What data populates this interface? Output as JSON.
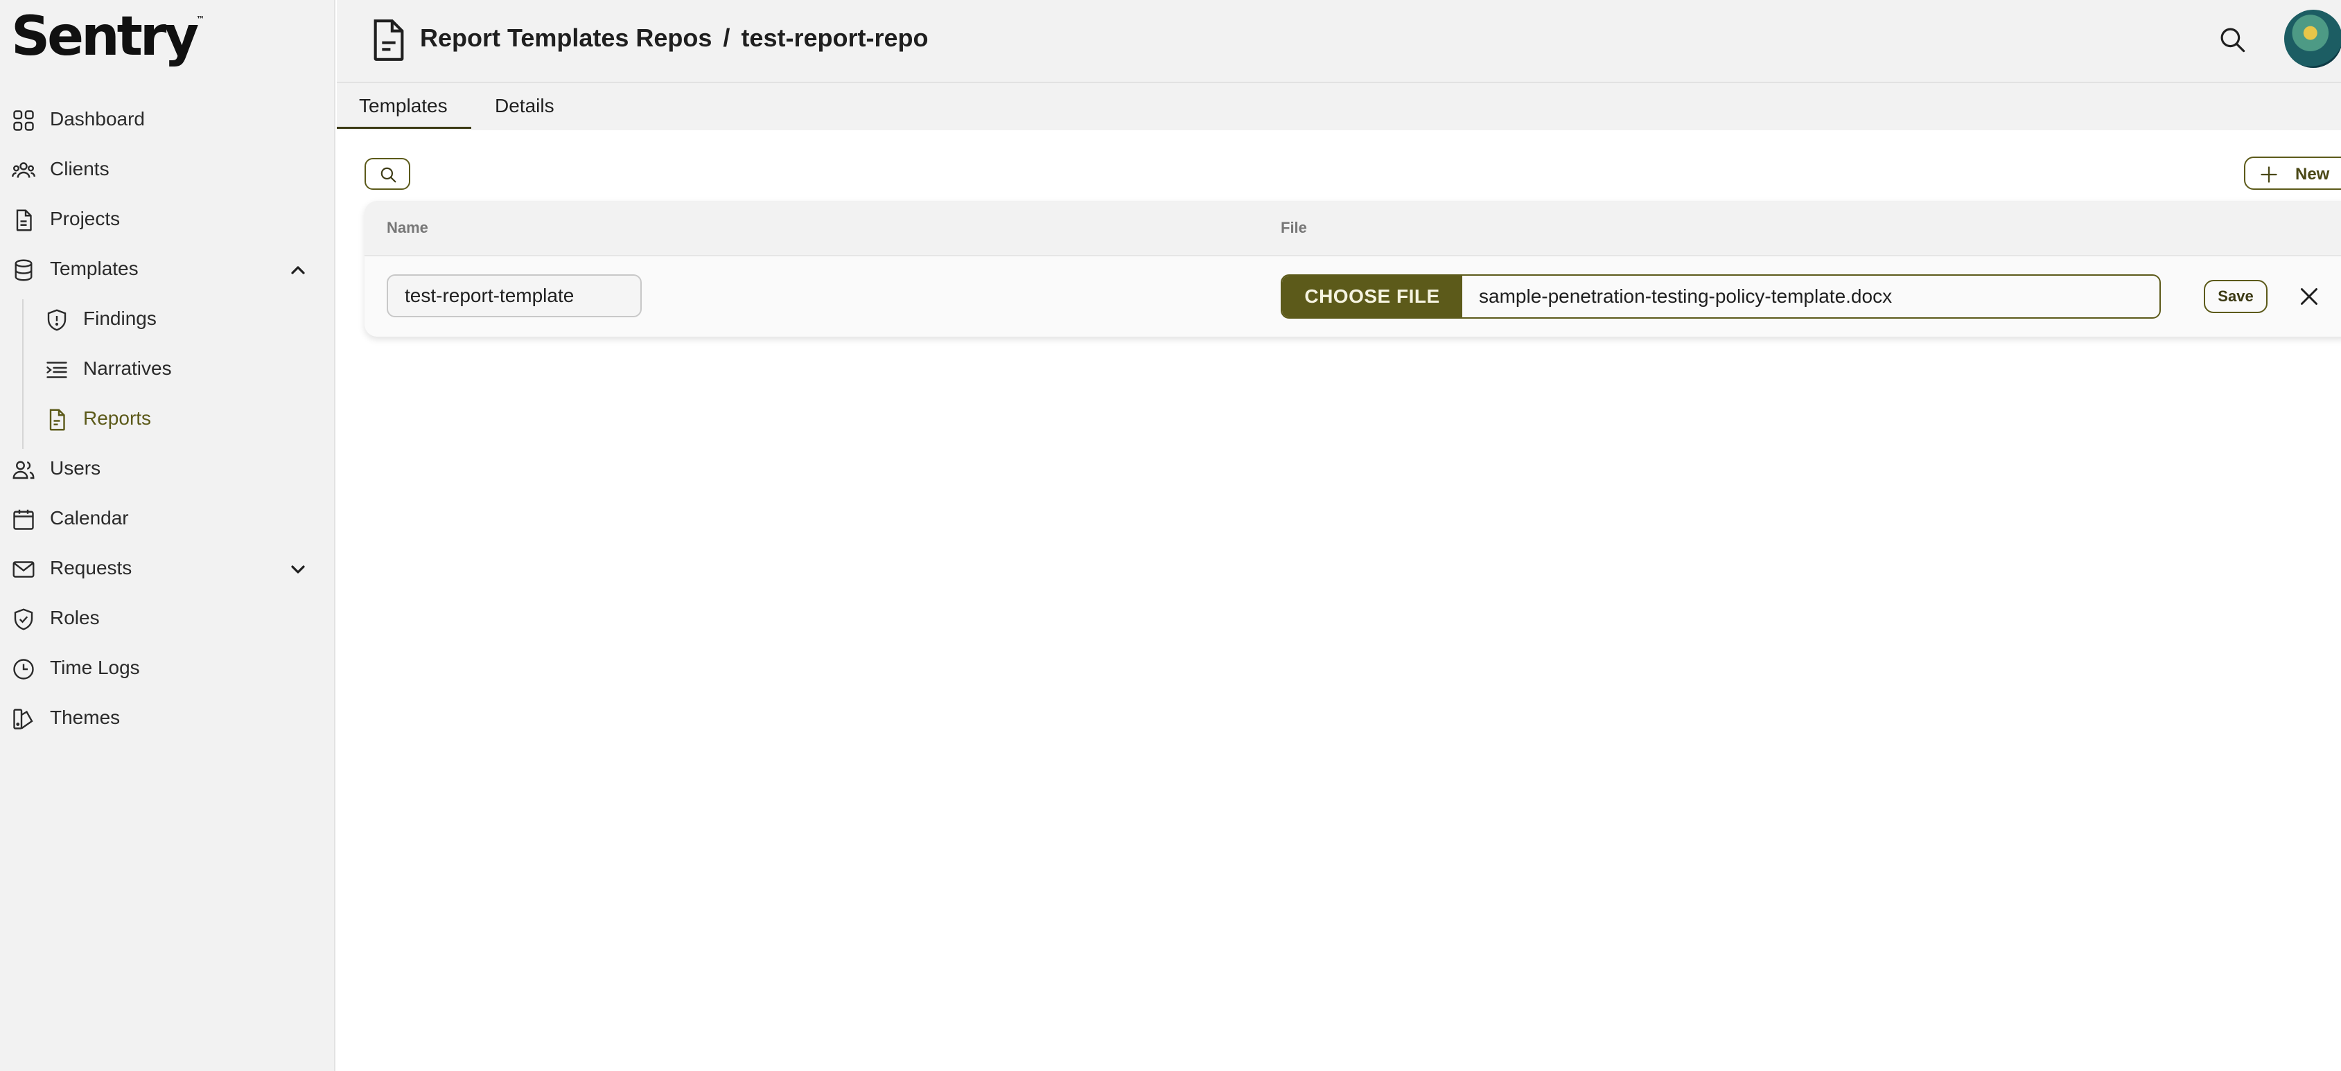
{
  "brand": {
    "logo_text": "Sentry",
    "logo_mark": "™"
  },
  "sidebar": {
    "items": [
      {
        "label": "Dashboard",
        "icon": "dashboard-grid-icon"
      },
      {
        "label": "Clients",
        "icon": "clients-group-icon"
      },
      {
        "label": "Projects",
        "icon": "projects-doc-icon"
      },
      {
        "label": "Templates",
        "icon": "database-icon",
        "expanded": true
      },
      {
        "label": "Findings",
        "icon": "shield-alert-icon"
      },
      {
        "label": "Narratives",
        "icon": "list-indent-icon"
      },
      {
        "label": "Reports",
        "icon": "report-doc-icon",
        "active": true
      },
      {
        "label": "Users",
        "icon": "users-icon"
      },
      {
        "label": "Calendar",
        "icon": "calendar-icon"
      },
      {
        "label": "Requests",
        "icon": "mail-icon",
        "expanded": false
      },
      {
        "label": "Roles",
        "icon": "shield-check-icon"
      },
      {
        "label": "Time Logs",
        "icon": "clock-icon"
      },
      {
        "label": "Themes",
        "icon": "palette-icon"
      }
    ]
  },
  "header": {
    "breadcrumb_parent": "Report Templates Repos",
    "breadcrumb_separator": "/",
    "breadcrumb_current": "test-report-repo"
  },
  "tabs": [
    {
      "label": "Templates",
      "active": true
    },
    {
      "label": "Details",
      "active": false
    }
  ],
  "toolbar": {
    "new_label": "New"
  },
  "table": {
    "columns": [
      "Name",
      "File"
    ],
    "row": {
      "name_value": "test-report-template",
      "choose_file_label": "CHOOSE FILE",
      "file_name": "sample-penetration-testing-policy-template.docx",
      "save_label": "Save"
    }
  },
  "colors": {
    "accent": "#5c5a1a",
    "sidebar_bg": "#f2f2f2",
    "active_text": "#5c5a1a"
  }
}
